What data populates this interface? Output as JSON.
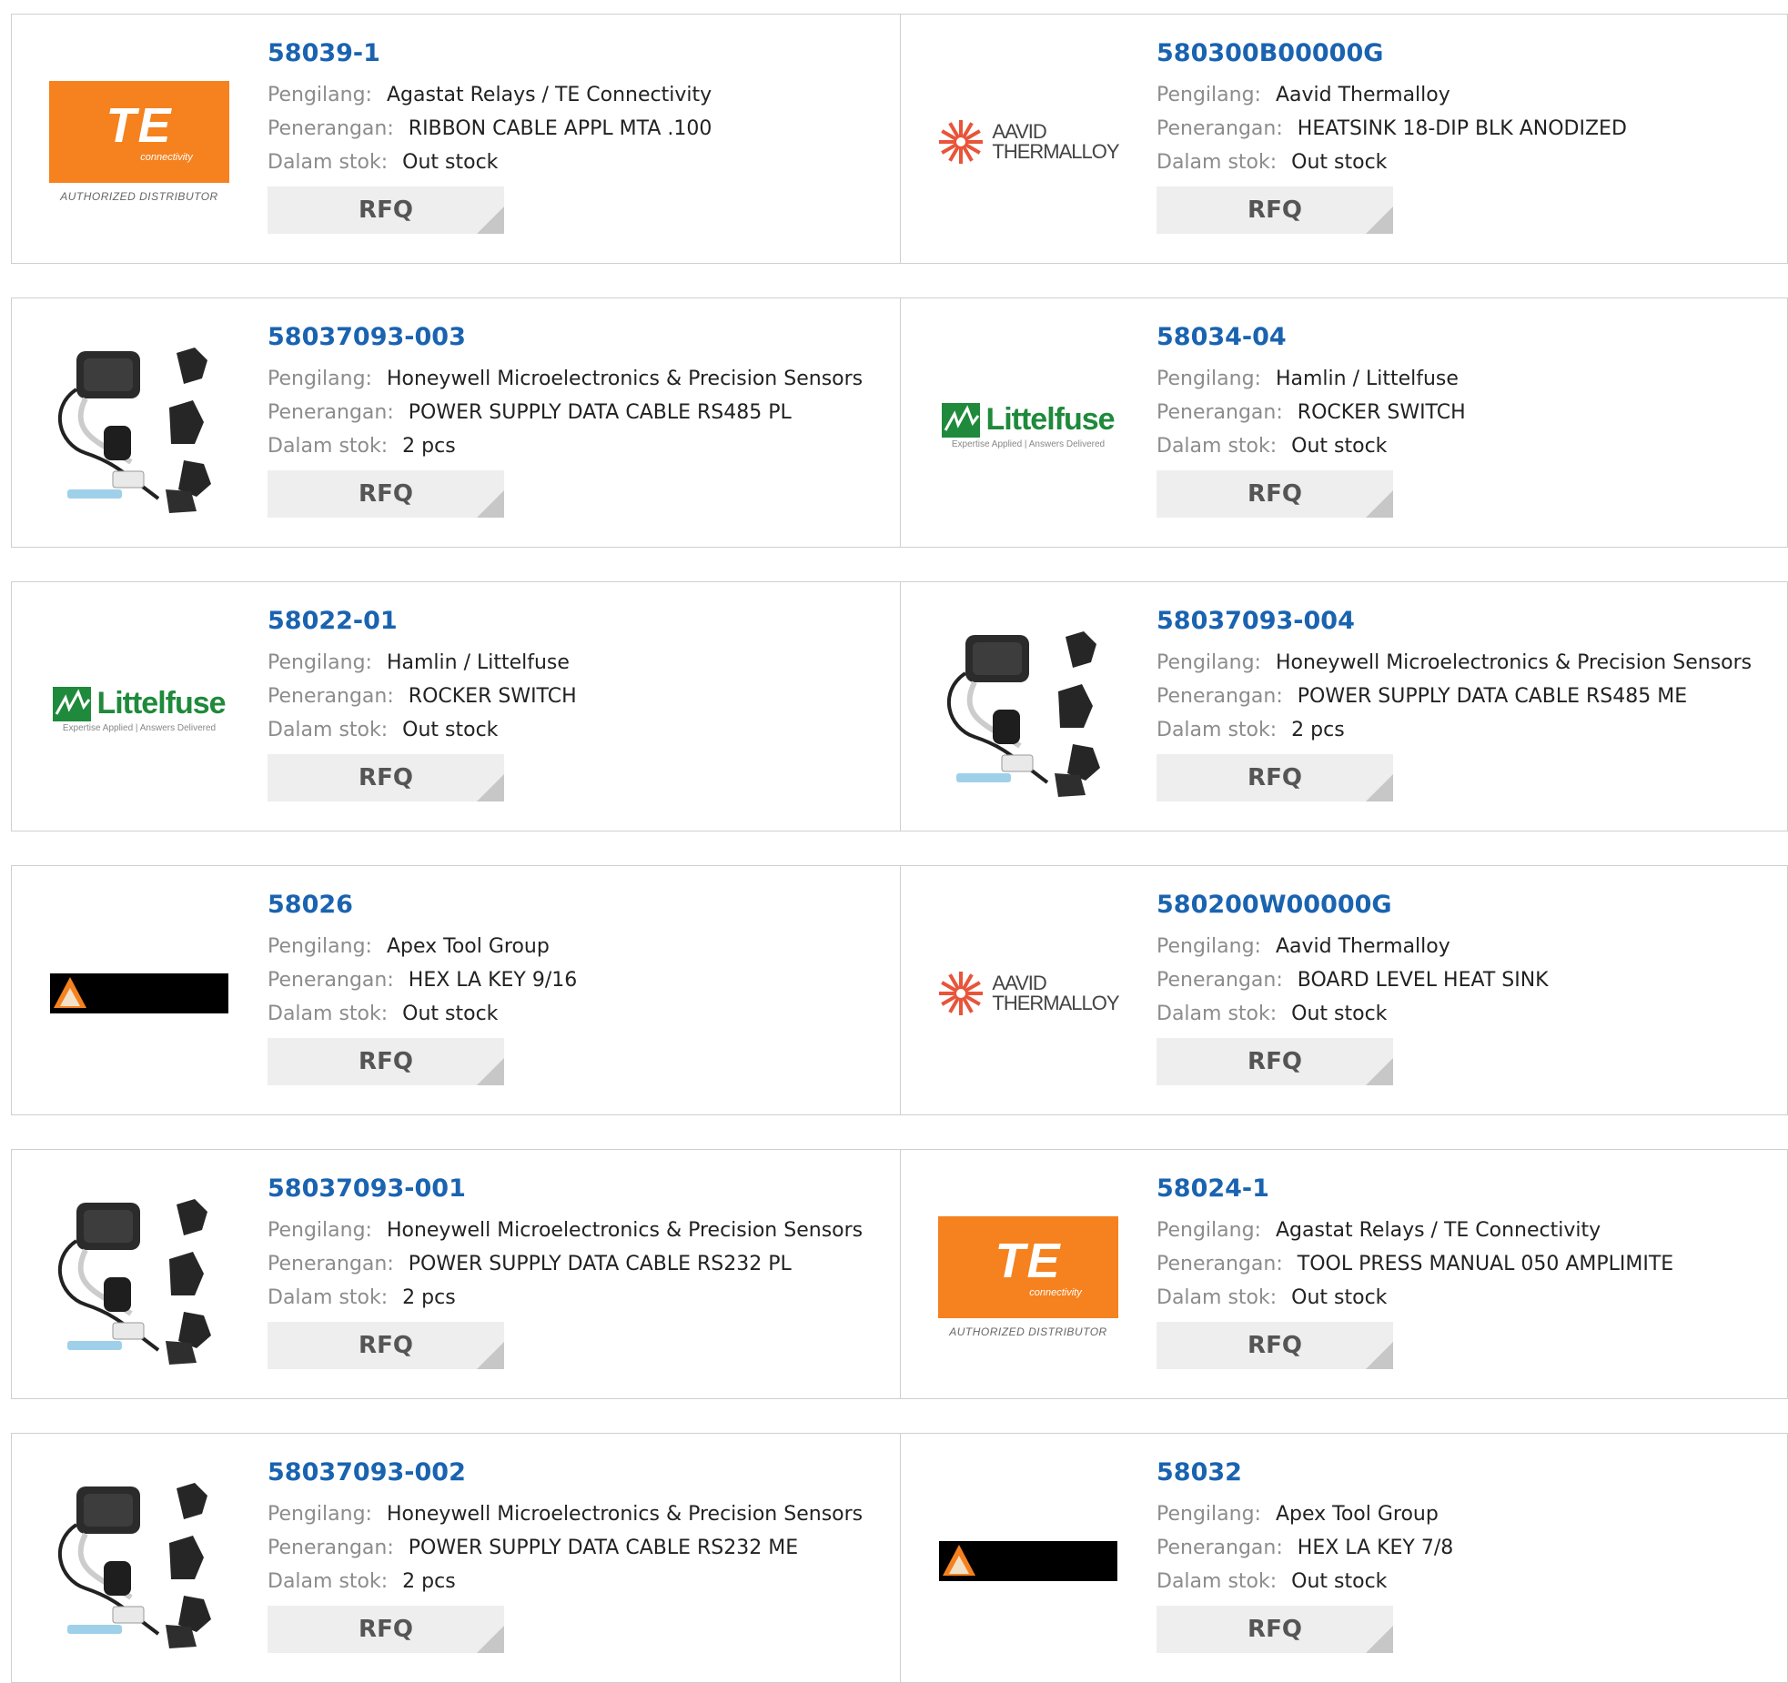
{
  "labels": {
    "manufacturer": "Pengilang:",
    "description": "Penerangan:",
    "stock": "Dalam stok:",
    "rfq": "RFQ"
  },
  "products": [
    {
      "part": "58039-1",
      "manufacturer": "Agastat Relays / TE Connectivity",
      "description": "RIBBON CABLE APPL MTA .100",
      "stock": "Out stock",
      "logo": "te",
      "logo_text": {
        "mark": "TE",
        "sub": "connectivity",
        "auth": "AUTHORIZED DISTRIBUTOR"
      }
    },
    {
      "part": "580300B00000G",
      "manufacturer": "Aavid Thermalloy",
      "description": "HEATSINK 18-DIP BLK ANODIZED",
      "stock": "Out stock",
      "logo": "aavid",
      "logo_text": {
        "line1": "AAVID",
        "line2": "THERMALLOY"
      }
    },
    {
      "part": "58037093-003",
      "manufacturer": "Honeywell Microelectronics & Precision Sensors",
      "description": "POWER SUPPLY DATA CABLE RS485 PL",
      "stock": "2 pcs",
      "logo": "power"
    },
    {
      "part": "58034-04",
      "manufacturer": "Hamlin / Littelfuse",
      "description": "ROCKER SWITCH",
      "stock": "Out stock",
      "logo": "littelfuse",
      "logo_text": {
        "name": "Littelfuse",
        "tag": "Expertise Applied | Answers Delivered"
      }
    },
    {
      "part": "58022-01",
      "manufacturer": "Hamlin / Littelfuse",
      "description": "ROCKER SWITCH",
      "stock": "Out stock",
      "logo": "littelfuse",
      "logo_text": {
        "name": "Littelfuse",
        "tag": "Expertise Applied | Answers Delivered"
      }
    },
    {
      "part": "58037093-004",
      "manufacturer": "Honeywell Microelectronics & Precision Sensors",
      "description": "POWER SUPPLY DATA CABLE RS485 ME",
      "stock": "2 pcs",
      "logo": "power"
    },
    {
      "part": "58026",
      "manufacturer": "Apex Tool Group",
      "description": "HEX LA KEY 9/16",
      "stock": "Out stock",
      "logo": "apex"
    },
    {
      "part": "580200W00000G",
      "manufacturer": "Aavid Thermalloy",
      "description": "BOARD LEVEL HEAT SINK",
      "stock": "Out stock",
      "logo": "aavid",
      "logo_text": {
        "line1": "AAVID",
        "line2": "THERMALLOY"
      }
    },
    {
      "part": "58037093-001",
      "manufacturer": "Honeywell Microelectronics & Precision Sensors",
      "description": "POWER SUPPLY DATA CABLE RS232 PL",
      "stock": "2 pcs",
      "logo": "power"
    },
    {
      "part": "58024-1",
      "manufacturer": "Agastat Relays / TE Connectivity",
      "description": "TOOL PRESS MANUAL 050 AMPLIMITE",
      "stock": "Out stock",
      "logo": "te",
      "logo_text": {
        "mark": "TE",
        "sub": "connectivity",
        "auth": "AUTHORIZED DISTRIBUTOR"
      }
    },
    {
      "part": "58037093-002",
      "manufacturer": "Honeywell Microelectronics & Precision Sensors",
      "description": "POWER SUPPLY DATA CABLE RS232 ME",
      "stock": "2 pcs",
      "logo": "power"
    },
    {
      "part": "58032",
      "manufacturer": "Apex Tool Group",
      "description": "HEX LA KEY 7/8",
      "stock": "Out stock",
      "logo": "apex"
    }
  ],
  "colors": {
    "part_link": "#1a63b0",
    "te_orange": "#f5821f",
    "littelfuse_green": "#1f8a3b",
    "aavid_red": "#e8553a"
  }
}
